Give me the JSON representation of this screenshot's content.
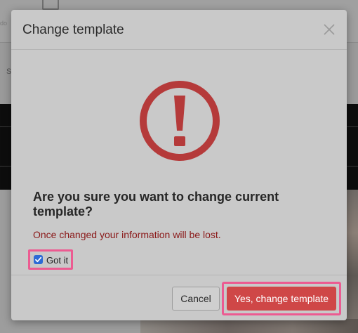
{
  "background": {
    "undo_label": "do",
    "nav_letter": "S"
  },
  "modal": {
    "title": "Change template",
    "close_icon": "close-icon",
    "warning_icon": "exclamation-circle-icon",
    "question": "Are you sure you want to change current template?",
    "warning": "Once changed your information will be lost.",
    "checkbox": {
      "label": "Got it",
      "checked": true
    },
    "buttons": {
      "cancel": "Cancel",
      "confirm": "Yes, change template"
    }
  },
  "colors": {
    "warning_red": "#b53a3a",
    "warning_text": "#8a1818",
    "confirm_button": "#cf4747",
    "highlight_outline": "#ec5b91",
    "checkbox_blue": "#2d6ad6"
  }
}
